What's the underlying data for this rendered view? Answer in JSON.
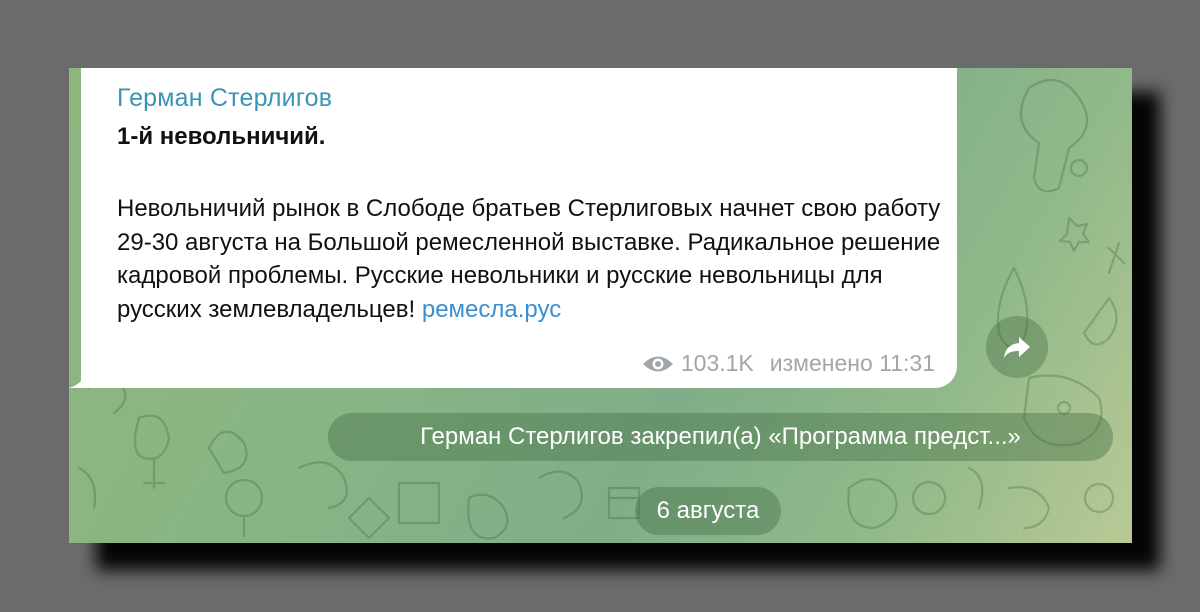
{
  "message": {
    "sender": "Герман Стерлигов",
    "title": "1-й невольничий.",
    "body": "Невольничий рынок в Слободе братьев Стерлиговых начнет свою работу 29-30 августа на Большой ремесленной выставке. Радикальное решение кадровой проблемы. Русские невольники и русские невольницы для русских землевладельцев!",
    "link": "ремесла.рус",
    "views": "103.1K",
    "edited_time": "изменено 11:31"
  },
  "service": {
    "pinned_notice": "Герман Стерлигов закрепил(а) «Программа предст...»",
    "date_separator": "6 августа"
  },
  "icons": {
    "views": "eye-icon",
    "forward": "forward-arrow-icon"
  },
  "colors": {
    "sender": "#3a95b4",
    "link": "#3a8fd0",
    "meta": "#a0a6ab",
    "bubble": "#ffffff",
    "page_background": "#6b6b6b"
  }
}
